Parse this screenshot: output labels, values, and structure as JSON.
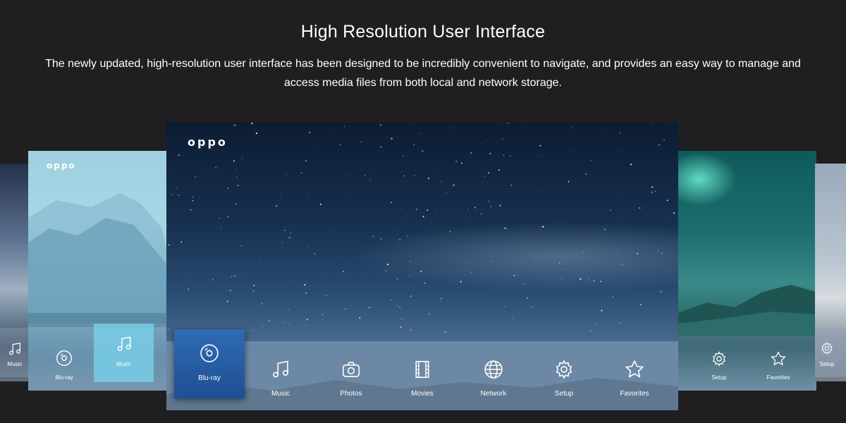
{
  "heading": {
    "title": "High Resolution User Interface",
    "description": "The newly updated, high-resolution user interface has been designed to be incredibly convenient to navigate, and provides an easy way to manage and access media files from both local and network storage."
  },
  "brand_logo": "oppo",
  "panels": {
    "far_left": {
      "items": [
        {
          "label": "Music",
          "icon": "music-icon"
        }
      ]
    },
    "left": {
      "items": [
        {
          "label": "Blu-ray",
          "icon": "disc-icon"
        },
        {
          "label": "Music",
          "icon": "music-icon",
          "highlighted": true
        }
      ]
    },
    "main": {
      "items": [
        {
          "label": "Blu-ray",
          "icon": "disc-icon",
          "highlighted": true
        },
        {
          "label": "Music",
          "icon": "music-icon"
        },
        {
          "label": "Photos",
          "icon": "camera-icon"
        },
        {
          "label": "Movies",
          "icon": "film-icon"
        },
        {
          "label": "Network",
          "icon": "globe-icon"
        },
        {
          "label": "Setup",
          "icon": "gear-icon"
        },
        {
          "label": "Favorites",
          "icon": "star-icon"
        }
      ]
    },
    "right": {
      "items": [
        {
          "label": "Setup",
          "icon": "gear-icon"
        },
        {
          "label": "Favorites",
          "icon": "star-icon"
        }
      ]
    },
    "far_right": {
      "items": [
        {
          "label": "Setup",
          "icon": "gear-icon"
        }
      ]
    }
  },
  "colors": {
    "page_background": "#1f1e20",
    "highlight_main": "#2a62a8",
    "highlight_left": "#78cde6"
  }
}
